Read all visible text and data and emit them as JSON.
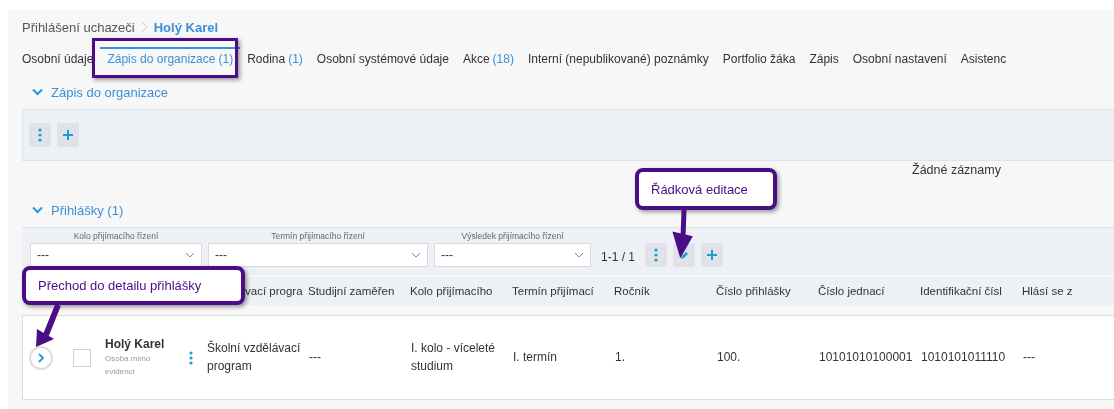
{
  "breadcrumb": [
    {
      "label": "Přihlášení uchazeči",
      "current": false
    },
    {
      "label": "Holý Karel",
      "current": true
    }
  ],
  "tabs": [
    {
      "label": "Osobní údaje",
      "selected": false
    },
    {
      "label": "Zápis do organizace",
      "count": "(1)",
      "selected": true
    },
    {
      "label": "Rodina",
      "count": "(1)",
      "selected": false
    },
    {
      "label": "Osobní systémové údaje",
      "selected": false
    },
    {
      "label": "Akce",
      "count": "(18)",
      "selected": false
    },
    {
      "label": "Interní (nepublikované) poznámky",
      "selected": false
    },
    {
      "label": "Portfolio žáka",
      "selected": false
    },
    {
      "label": "Zápis",
      "selected": false
    },
    {
      "label": "Osobní nastavení",
      "selected": false
    },
    {
      "label": "Asistenc",
      "selected": false
    }
  ],
  "enrollment_section": {
    "title": "Zápis do organizace",
    "expanded": true,
    "empty_message": "Žádné záznamy"
  },
  "applications_section": {
    "title": "Přihlášky (1)",
    "expanded": true,
    "filters": [
      {
        "label": "Kolo přijímacího řízení",
        "value": "---"
      },
      {
        "label": "Termín přijímacího řízení",
        "value": "---"
      },
      {
        "label": "Výsledek přijímacího řízení",
        "value": "---"
      }
    ],
    "pager": "1-1 / 1",
    "columns": [
      "vací progra",
      "Studijní zaměřen",
      "Kolo přijímacího",
      "Termín přijímací",
      "Ročník",
      "Číslo přihlášky",
      "Číslo jednací",
      "Identifikační čísl",
      "Hlásí se z"
    ],
    "rows": [
      {
        "name": "Holý Karel",
        "note": "Osoba mimo evidenci",
        "checked": false,
        "cells": [
          "Školní vzdělávací program",
          "---",
          "I. kolo - víceleté studium",
          "I. termín",
          "1.",
          "100.",
          "10101010100001",
          "1010101011110",
          "---"
        ]
      }
    ]
  },
  "callouts": [
    {
      "text": "Řádková editace"
    },
    {
      "text": "Přechod do detailu přihlášky"
    }
  ]
}
